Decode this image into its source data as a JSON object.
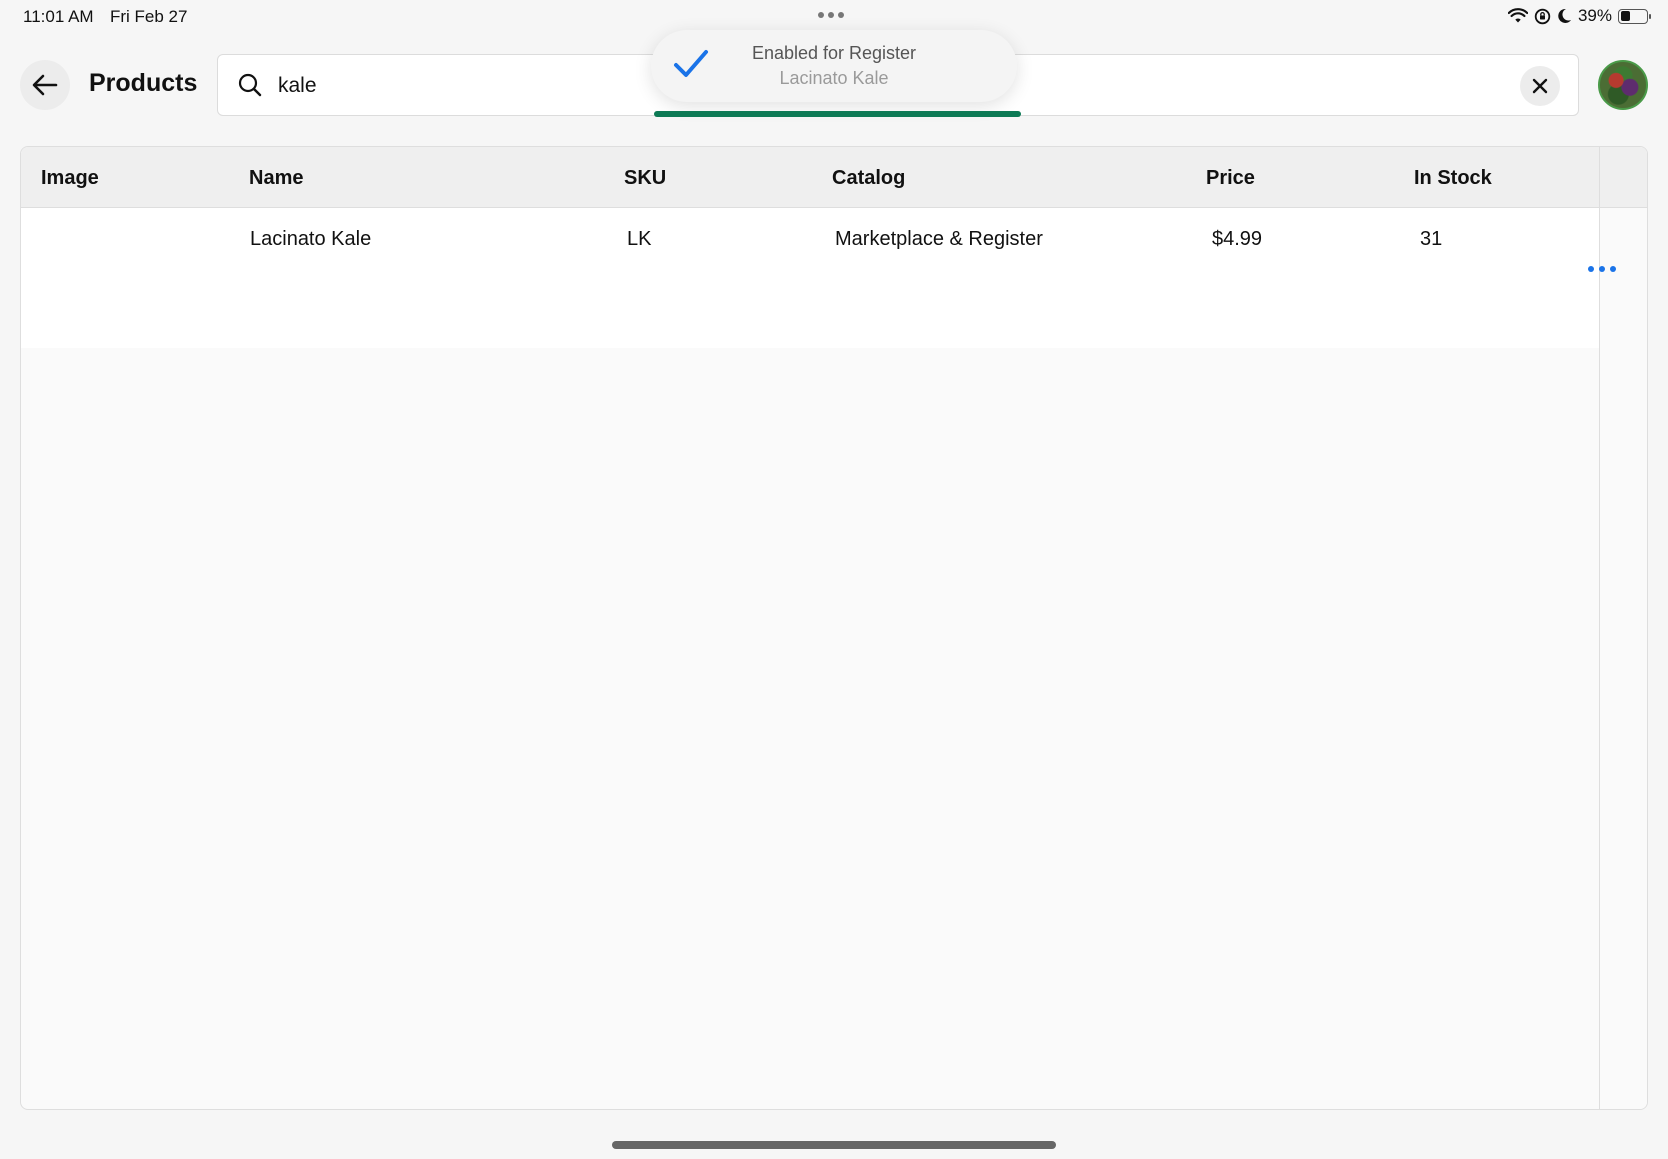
{
  "status_bar": {
    "time": "11:01 AM",
    "date": "Fri Feb 27",
    "battery_percent": "39%",
    "battery_level": 0.39
  },
  "header": {
    "title": "Products",
    "search_value": "kale",
    "back_icon": "arrow-left-icon",
    "search_icon": "search-icon",
    "clear_icon": "close-icon"
  },
  "toast": {
    "title": "Enabled for Register",
    "subtitle": "Lacinato Kale",
    "icon": "checkmark-icon",
    "progress": 1.0,
    "progress_color": "#0d7a55"
  },
  "table": {
    "columns": [
      "Image",
      "Name",
      "SKU",
      "Catalog",
      "Price",
      "In Stock"
    ],
    "rows": [
      {
        "image": "",
        "name": "Lacinato Kale",
        "sku": "LK",
        "catalog": "Marketplace & Register",
        "price": "$4.99",
        "in_stock": "31"
      }
    ]
  },
  "colors": {
    "accent": "#1a73e8",
    "success": "#0d7a55"
  }
}
